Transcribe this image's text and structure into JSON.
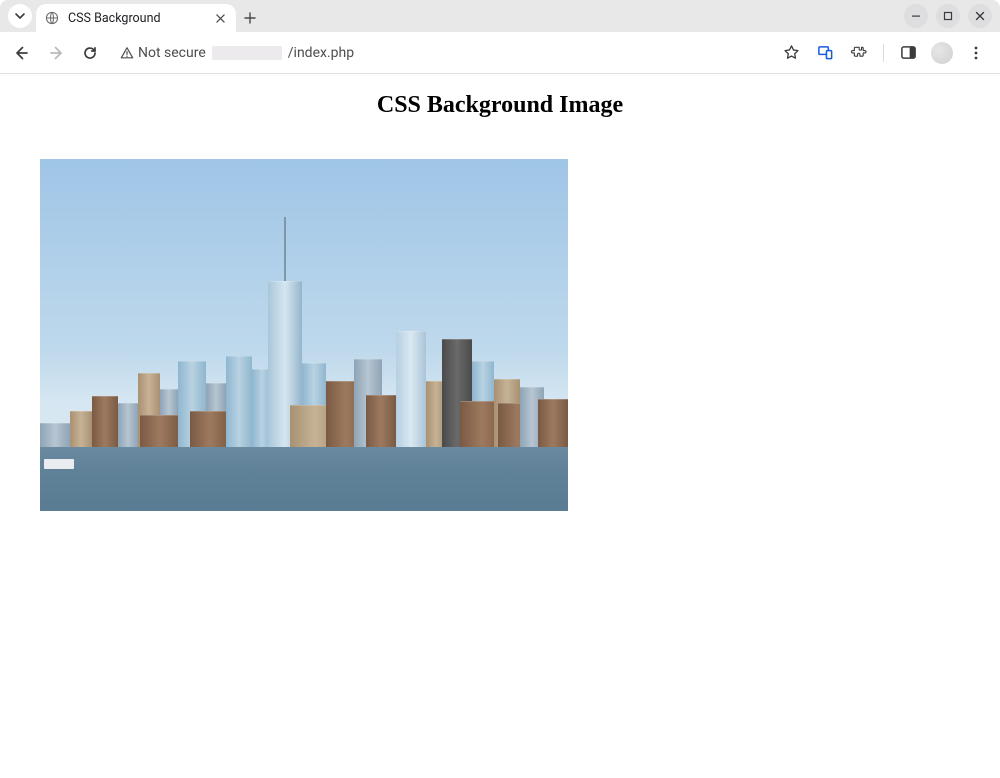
{
  "browser": {
    "tab_title": "CSS Background",
    "address": {
      "security_label": "Not secure",
      "path": "/index.php"
    }
  },
  "page": {
    "heading": "CSS Background Image"
  }
}
